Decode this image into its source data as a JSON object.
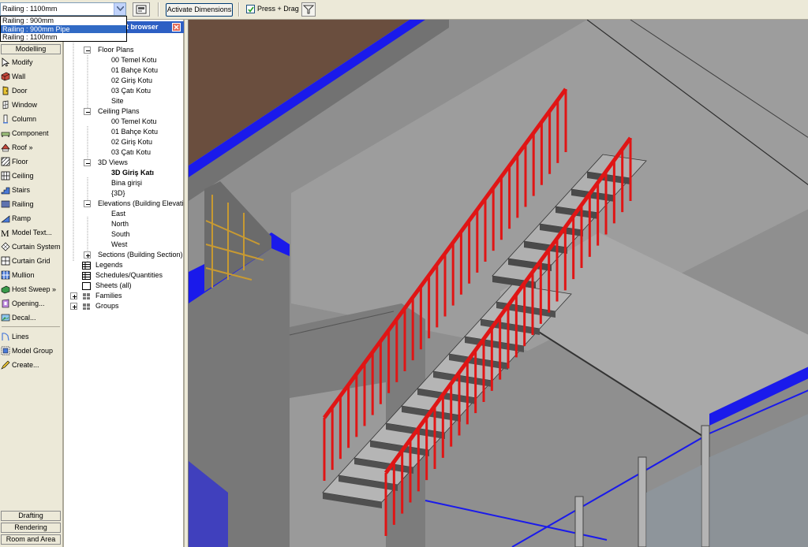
{
  "options_bar": {
    "type_selector_value": "Railing : 1100mm",
    "dropdown_options": [
      "Railing : 900mm",
      "Railing : 900mm Pipe",
      "Railing : 1100mm"
    ],
    "activate_dimensions_label": "Activate Dimensions",
    "press_drag_label": "Press + Drag",
    "press_drag_checked": true
  },
  "design_bar": {
    "top_tab": "Modelling",
    "tools": [
      {
        "label": "Modify",
        "icon": "arrow-cursor-icon"
      },
      {
        "label": "Wall",
        "icon": "wall-icon"
      },
      {
        "label": "Door",
        "icon": "door-icon"
      },
      {
        "label": "Window",
        "icon": "window-icon"
      },
      {
        "label": "Column",
        "icon": "column-icon"
      },
      {
        "label": "Component",
        "icon": "component-icon"
      },
      {
        "label": "Roof »",
        "icon": "roof-icon"
      },
      {
        "label": "Floor",
        "icon": "floor-icon"
      },
      {
        "label": "Ceiling",
        "icon": "ceiling-icon"
      },
      {
        "label": "Stairs",
        "icon": "stairs-icon"
      },
      {
        "label": "Railing",
        "icon": "railing-icon"
      },
      {
        "label": "Ramp",
        "icon": "ramp-icon"
      },
      {
        "label": "Model Text...",
        "icon": "model-text-icon"
      },
      {
        "label": "Curtain System",
        "icon": "curtain-system-icon"
      },
      {
        "label": "Curtain Grid",
        "icon": "curtain-grid-icon"
      },
      {
        "label": "Mullion",
        "icon": "mullion-icon"
      },
      {
        "label": "Host Sweep »",
        "icon": "host-sweep-icon"
      },
      {
        "label": "Opening...",
        "icon": "opening-icon"
      },
      {
        "label": "Decal...",
        "icon": "decal-icon"
      },
      {
        "label": "Lines",
        "icon": "lines-icon"
      },
      {
        "label": "Model Group",
        "icon": "model-group-icon"
      },
      {
        "label": "Create...",
        "icon": "create-icon"
      }
    ],
    "bottom_tabs": [
      "Drafting",
      "Rendering",
      "Room and Area"
    ]
  },
  "project_browser": {
    "title": "Project browser",
    "title_visible": "ct browser",
    "items": [
      {
        "label": "Floor Plans",
        "expander": "minus"
      },
      {
        "label": "00 Temel Kotu"
      },
      {
        "label": "01 Bahçe Kotu"
      },
      {
        "label": "02 Giriş Kotu"
      },
      {
        "label": "03 Çatı Kotu"
      },
      {
        "label": "Site"
      },
      {
        "label": "Ceiling Plans",
        "expander": "minus"
      },
      {
        "label": "00 Temel Kotu"
      },
      {
        "label": "01 Bahçe Kotu"
      },
      {
        "label": "02 Giriş Kotu"
      },
      {
        "label": "03 Çatı Kotu"
      },
      {
        "label": "3D Views",
        "expander": "minus"
      },
      {
        "label": "3D Giriş Katı",
        "bold": true
      },
      {
        "label": "Bina girişi"
      },
      {
        "label": "{3D}"
      },
      {
        "label": "Elevations (Building Elevation)",
        "expander": "minus"
      },
      {
        "label": "East"
      },
      {
        "label": "North"
      },
      {
        "label": "South"
      },
      {
        "label": "West"
      },
      {
        "label": "Sections (Building Section)",
        "expander": "plus"
      },
      {
        "label": "Legends"
      },
      {
        "label": "Schedules/Quantities"
      },
      {
        "label": "Sheets (all)"
      },
      {
        "label": "Families",
        "expander": "plus"
      },
      {
        "label": "Groups",
        "expander": "plus"
      }
    ]
  },
  "viewport": {
    "view": "3D Giriş Katı",
    "colors": {
      "railing": "#e01515",
      "wall_cut": "#1a1aeb",
      "floor": "#9a9a9a",
      "wall": "#6e6e6e",
      "roof": "#6a4e3e"
    }
  }
}
